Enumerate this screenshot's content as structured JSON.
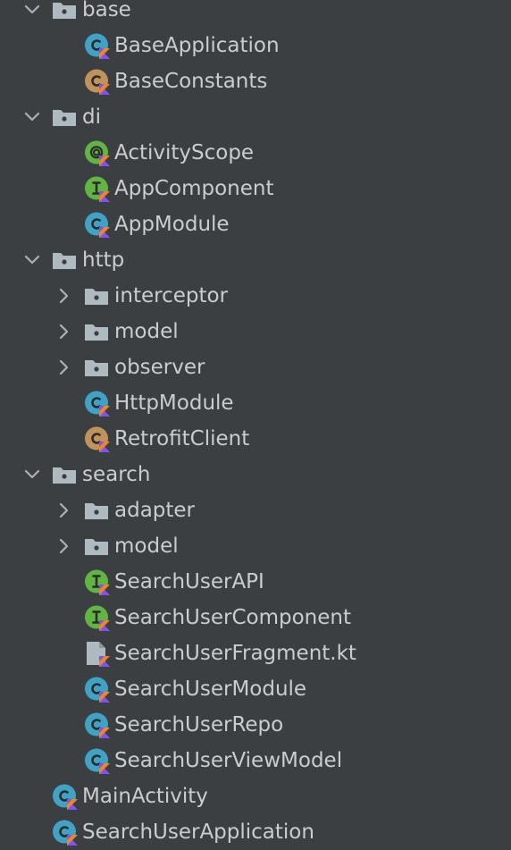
{
  "project_tree": {
    "nodes": [
      {
        "label": "base",
        "kind": "package",
        "expander": "expanded",
        "icon": "package-icon"
      },
      {
        "label": "BaseApplication",
        "kind": "class",
        "expander": "none",
        "icon": "kotlin-class-icon"
      },
      {
        "label": "BaseConstants",
        "kind": "object",
        "expander": "none",
        "icon": "kotlin-object-icon"
      },
      {
        "label": "di",
        "kind": "package",
        "expander": "expanded",
        "icon": "package-icon"
      },
      {
        "label": "ActivityScope",
        "kind": "annotation",
        "expander": "none",
        "icon": "kotlin-annotation-icon"
      },
      {
        "label": "AppComponent",
        "kind": "interface",
        "expander": "none",
        "icon": "kotlin-interface-icon"
      },
      {
        "label": "AppModule",
        "kind": "class",
        "expander": "none",
        "icon": "kotlin-class-icon"
      },
      {
        "label": "http",
        "kind": "package",
        "expander": "expanded",
        "icon": "package-icon"
      },
      {
        "label": "interceptor",
        "kind": "package",
        "expander": "collapsed",
        "icon": "package-icon"
      },
      {
        "label": "model",
        "kind": "package",
        "expander": "collapsed",
        "icon": "package-icon"
      },
      {
        "label": "observer",
        "kind": "package",
        "expander": "collapsed",
        "icon": "package-icon"
      },
      {
        "label": "HttpModule",
        "kind": "class",
        "expander": "none",
        "icon": "kotlin-class-icon"
      },
      {
        "label": "RetrofitClient",
        "kind": "object",
        "expander": "none",
        "icon": "kotlin-object-icon"
      },
      {
        "label": "search",
        "kind": "package",
        "expander": "expanded",
        "icon": "package-icon"
      },
      {
        "label": "adapter",
        "kind": "package",
        "expander": "collapsed",
        "icon": "package-icon"
      },
      {
        "label": "model",
        "kind": "package",
        "expander": "collapsed",
        "icon": "package-icon"
      },
      {
        "label": "SearchUserAPI",
        "kind": "interface",
        "expander": "none",
        "icon": "kotlin-interface-icon"
      },
      {
        "label": "SearchUserComponent",
        "kind": "interface",
        "expander": "none",
        "icon": "kotlin-interface-icon"
      },
      {
        "label": "SearchUserFragment.kt",
        "kind": "file",
        "expander": "none",
        "icon": "kotlin-file-icon"
      },
      {
        "label": "SearchUserModule",
        "kind": "class",
        "expander": "none",
        "icon": "kotlin-class-icon"
      },
      {
        "label": "SearchUserRepo",
        "kind": "class",
        "expander": "none",
        "icon": "kotlin-class-icon"
      },
      {
        "label": "SearchUserViewModel",
        "kind": "class",
        "expander": "none",
        "icon": "kotlin-class-icon"
      },
      {
        "label": "MainActivity",
        "kind": "class",
        "expander": "none",
        "icon": "kotlin-class-icon"
      },
      {
        "label": "SearchUserApplication",
        "kind": "class",
        "expander": "none",
        "icon": "kotlin-class-icon"
      }
    ]
  },
  "colors": {
    "background": "#3c3f41",
    "text": "#c9cdd1",
    "chevron": "#aab0b5",
    "folder": "#aeb9c0",
    "class": "#40a3c4",
    "object": "#bf935a",
    "interface": "#62b543",
    "annotation": "#62b543",
    "kotlin_orange": "#f0861f",
    "kotlin_purple": "#7f52ff"
  }
}
